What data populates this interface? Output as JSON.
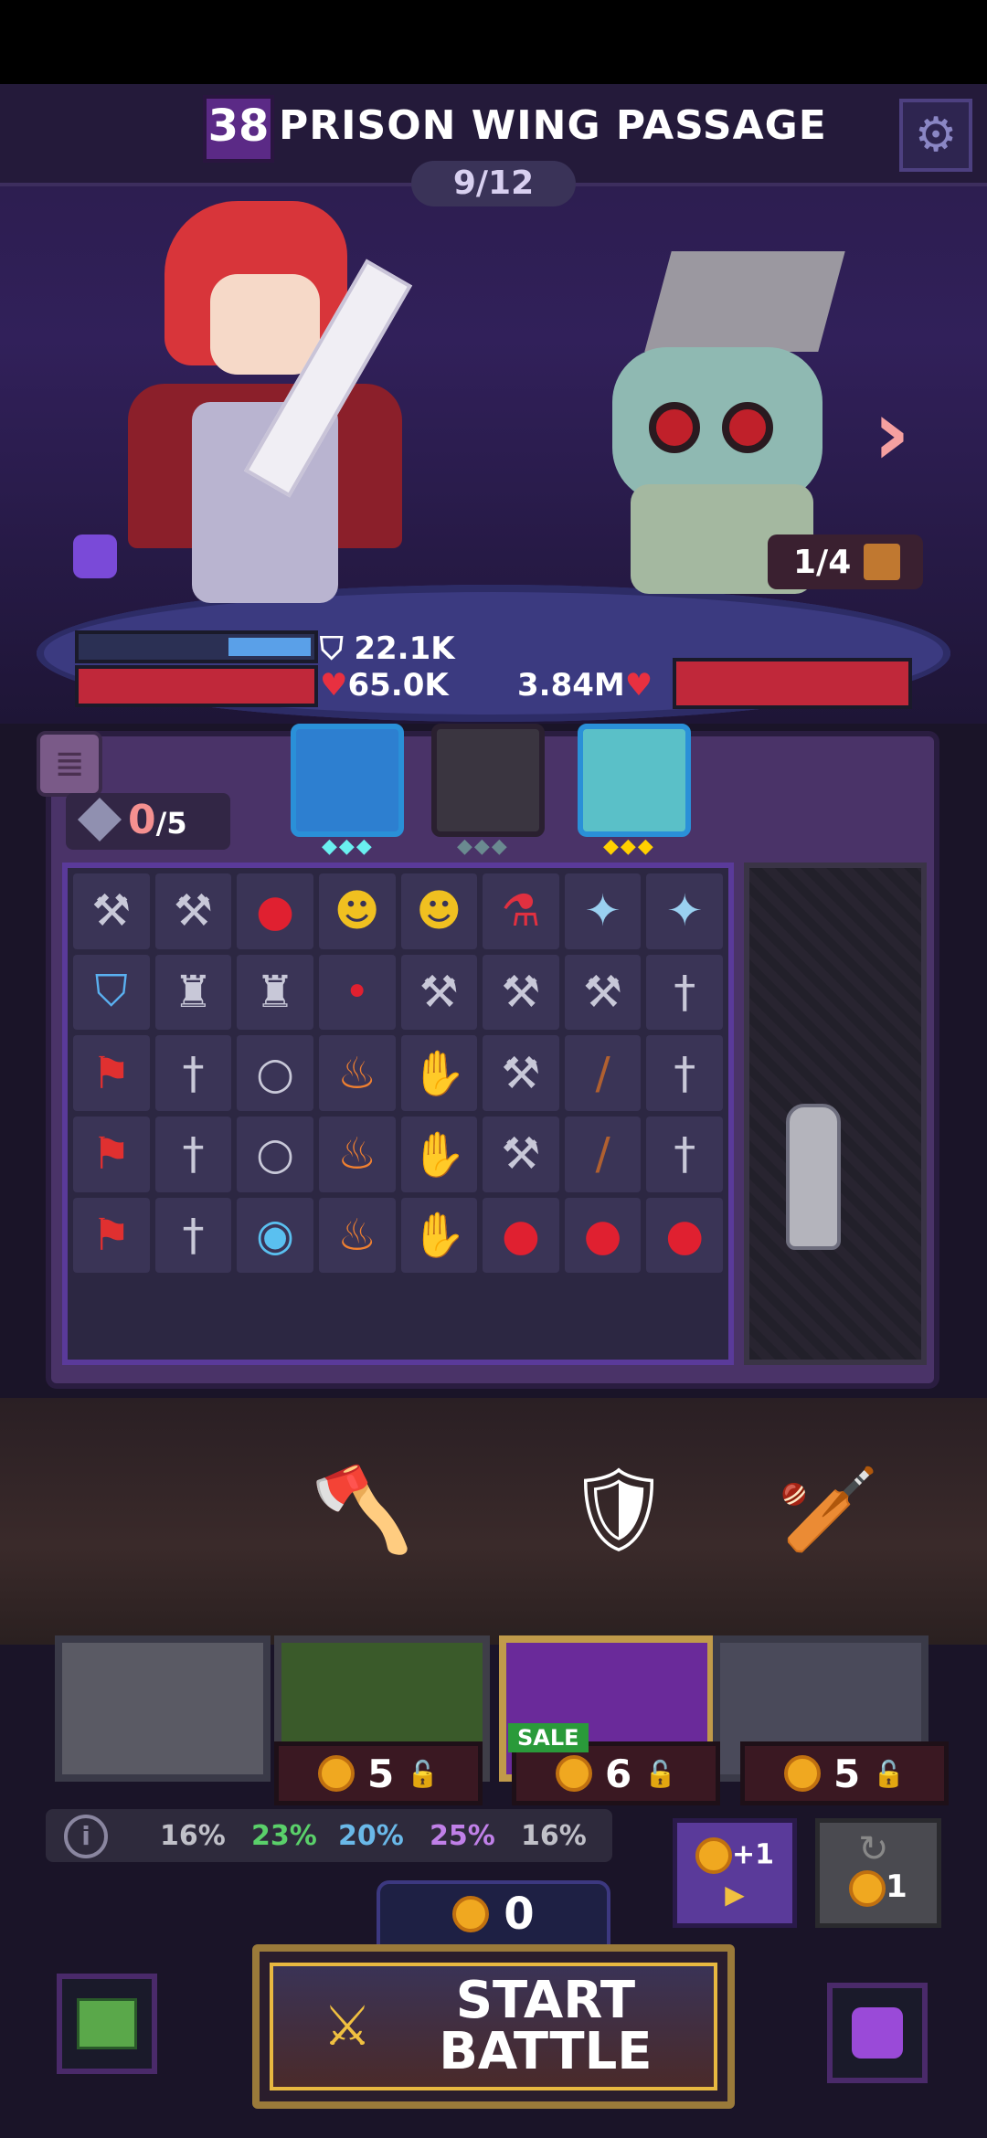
{
  "header": {
    "level": "38",
    "title": "PRISON WING PASSAGE",
    "wave": "9/12"
  },
  "hero": {
    "shield": "22.1K",
    "hp": "65.0K"
  },
  "enemy": {
    "hp": "3.84M",
    "counter": "1/4"
  },
  "backpack": {
    "gems": "0",
    "gems_max": "/5",
    "grid_icons": [
      "anvil-icon",
      "anvil-icon",
      "ruby-icon",
      "gold-coins-icon",
      "gold-coins-icon",
      "potion-icon",
      "fairy-icon",
      "fairy-icon",
      "shield-icon",
      "armor-icon",
      "armor-icon",
      "ruby-small-icon",
      "hammer-icon",
      "hammer-icon",
      "hammer-icon",
      "sword-icon",
      "banner-icon",
      "sword-icon",
      "ring-icon",
      "torch-icon",
      "glove-icon",
      "hammer-icon",
      "staff-icon",
      "sword-icon",
      "banner-icon",
      "sword-icon",
      "ring-icon",
      "torch-icon",
      "glove-icon",
      "hammer-icon",
      "staff-icon",
      "sword-icon",
      "banner-icon",
      "sword-icon",
      "eye-icon",
      "torch-icon",
      "glove-red-icon",
      "apple-icon",
      "apple-icon",
      "apple-icon"
    ]
  },
  "shop": {
    "prices": [
      "5",
      "6",
      "5"
    ],
    "sale": "SALE",
    "odds": [
      "16%",
      "23%",
      "20%",
      "25%",
      "16%"
    ],
    "coin_bonus": "+1",
    "reroll_cost": "1"
  },
  "gold": "0",
  "start_battle": "START BATTLE"
}
